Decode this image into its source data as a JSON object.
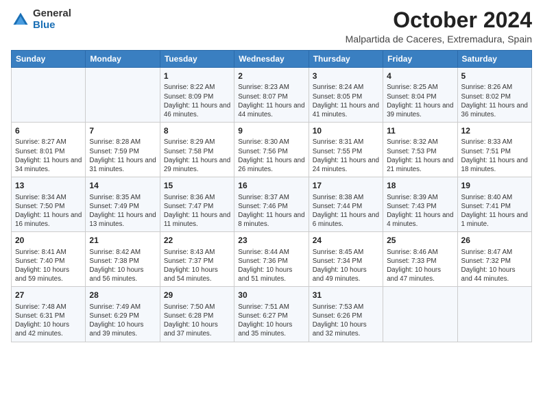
{
  "logo": {
    "general": "General",
    "blue": "Blue"
  },
  "title": "October 2024",
  "subtitle": "Malpartida de Caceres, Extremadura, Spain",
  "days_of_week": [
    "Sunday",
    "Monday",
    "Tuesday",
    "Wednesday",
    "Thursday",
    "Friday",
    "Saturday"
  ],
  "weeks": [
    [
      {
        "day": "",
        "info": ""
      },
      {
        "day": "",
        "info": ""
      },
      {
        "day": "1",
        "info": "Sunrise: 8:22 AM\nSunset: 8:09 PM\nDaylight: 11 hours and 46 minutes."
      },
      {
        "day": "2",
        "info": "Sunrise: 8:23 AM\nSunset: 8:07 PM\nDaylight: 11 hours and 44 minutes."
      },
      {
        "day": "3",
        "info": "Sunrise: 8:24 AM\nSunset: 8:05 PM\nDaylight: 11 hours and 41 minutes."
      },
      {
        "day": "4",
        "info": "Sunrise: 8:25 AM\nSunset: 8:04 PM\nDaylight: 11 hours and 39 minutes."
      },
      {
        "day": "5",
        "info": "Sunrise: 8:26 AM\nSunset: 8:02 PM\nDaylight: 11 hours and 36 minutes."
      }
    ],
    [
      {
        "day": "6",
        "info": "Sunrise: 8:27 AM\nSunset: 8:01 PM\nDaylight: 11 hours and 34 minutes."
      },
      {
        "day": "7",
        "info": "Sunrise: 8:28 AM\nSunset: 7:59 PM\nDaylight: 11 hours and 31 minutes."
      },
      {
        "day": "8",
        "info": "Sunrise: 8:29 AM\nSunset: 7:58 PM\nDaylight: 11 hours and 29 minutes."
      },
      {
        "day": "9",
        "info": "Sunrise: 8:30 AM\nSunset: 7:56 PM\nDaylight: 11 hours and 26 minutes."
      },
      {
        "day": "10",
        "info": "Sunrise: 8:31 AM\nSunset: 7:55 PM\nDaylight: 11 hours and 24 minutes."
      },
      {
        "day": "11",
        "info": "Sunrise: 8:32 AM\nSunset: 7:53 PM\nDaylight: 11 hours and 21 minutes."
      },
      {
        "day": "12",
        "info": "Sunrise: 8:33 AM\nSunset: 7:51 PM\nDaylight: 11 hours and 18 minutes."
      }
    ],
    [
      {
        "day": "13",
        "info": "Sunrise: 8:34 AM\nSunset: 7:50 PM\nDaylight: 11 hours and 16 minutes."
      },
      {
        "day": "14",
        "info": "Sunrise: 8:35 AM\nSunset: 7:49 PM\nDaylight: 11 hours and 13 minutes."
      },
      {
        "day": "15",
        "info": "Sunrise: 8:36 AM\nSunset: 7:47 PM\nDaylight: 11 hours and 11 minutes."
      },
      {
        "day": "16",
        "info": "Sunrise: 8:37 AM\nSunset: 7:46 PM\nDaylight: 11 hours and 8 minutes."
      },
      {
        "day": "17",
        "info": "Sunrise: 8:38 AM\nSunset: 7:44 PM\nDaylight: 11 hours and 6 minutes."
      },
      {
        "day": "18",
        "info": "Sunrise: 8:39 AM\nSunset: 7:43 PM\nDaylight: 11 hours and 4 minutes."
      },
      {
        "day": "19",
        "info": "Sunrise: 8:40 AM\nSunset: 7:41 PM\nDaylight: 11 hours and 1 minute."
      }
    ],
    [
      {
        "day": "20",
        "info": "Sunrise: 8:41 AM\nSunset: 7:40 PM\nDaylight: 10 hours and 59 minutes."
      },
      {
        "day": "21",
        "info": "Sunrise: 8:42 AM\nSunset: 7:38 PM\nDaylight: 10 hours and 56 minutes."
      },
      {
        "day": "22",
        "info": "Sunrise: 8:43 AM\nSunset: 7:37 PM\nDaylight: 10 hours and 54 minutes."
      },
      {
        "day": "23",
        "info": "Sunrise: 8:44 AM\nSunset: 7:36 PM\nDaylight: 10 hours and 51 minutes."
      },
      {
        "day": "24",
        "info": "Sunrise: 8:45 AM\nSunset: 7:34 PM\nDaylight: 10 hours and 49 minutes."
      },
      {
        "day": "25",
        "info": "Sunrise: 8:46 AM\nSunset: 7:33 PM\nDaylight: 10 hours and 47 minutes."
      },
      {
        "day": "26",
        "info": "Sunrise: 8:47 AM\nSunset: 7:32 PM\nDaylight: 10 hours and 44 minutes."
      }
    ],
    [
      {
        "day": "27",
        "info": "Sunrise: 7:48 AM\nSunset: 6:31 PM\nDaylight: 10 hours and 42 minutes."
      },
      {
        "day": "28",
        "info": "Sunrise: 7:49 AM\nSunset: 6:29 PM\nDaylight: 10 hours and 39 minutes."
      },
      {
        "day": "29",
        "info": "Sunrise: 7:50 AM\nSunset: 6:28 PM\nDaylight: 10 hours and 37 minutes."
      },
      {
        "day": "30",
        "info": "Sunrise: 7:51 AM\nSunset: 6:27 PM\nDaylight: 10 hours and 35 minutes."
      },
      {
        "day": "31",
        "info": "Sunrise: 7:53 AM\nSunset: 6:26 PM\nDaylight: 10 hours and 32 minutes."
      },
      {
        "day": "",
        "info": ""
      },
      {
        "day": "",
        "info": ""
      }
    ]
  ]
}
